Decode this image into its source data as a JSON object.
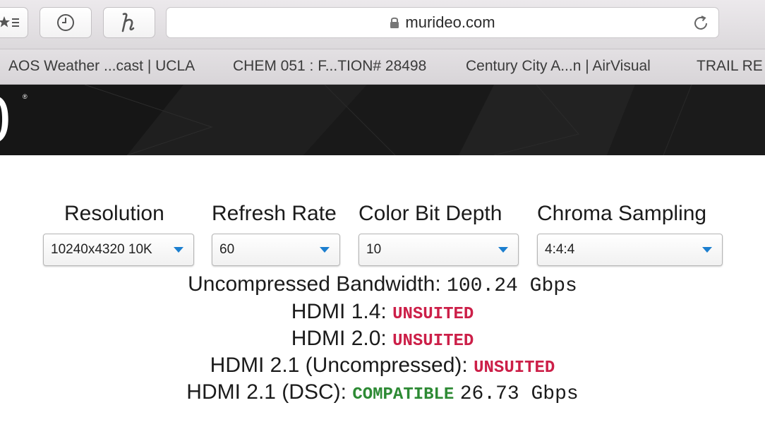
{
  "browser": {
    "url": "murideo.com",
    "bookmarks": [
      "AOS Weather ...cast | UCLA",
      "CHEM 051 : F...TION# 28498",
      "Century City A...n | AirVisual",
      "TRAIL RE"
    ]
  },
  "hero": {
    "glyph": "0",
    "registered": "®"
  },
  "calculator": {
    "resolution": {
      "label": "Resolution",
      "value": "10240x4320 10K"
    },
    "refresh_rate": {
      "label": "Refresh Rate",
      "value": "60"
    },
    "color_bit_depth": {
      "label": "Color Bit Depth",
      "value": "10"
    },
    "chroma_sampling": {
      "label": "Chroma Sampling",
      "value": "4:4:4"
    }
  },
  "results": {
    "bandwidth_label": "Uncompressed Bandwidth:",
    "bandwidth_value": "100.24 Gbps",
    "hdmi14_label": "HDMI 1.4:",
    "hdmi14_status": "UNSUITED",
    "hdmi20_label": "HDMI 2.0:",
    "hdmi20_status": "UNSUITED",
    "hdmi21u_label": "HDMI 2.1 (Uncompressed):",
    "hdmi21u_status": "UNSUITED",
    "hdmi21dsc_label": "HDMI 2.1 (DSC):",
    "hdmi21dsc_status": "COMPATIBLE",
    "hdmi21dsc_value": "26.73 Gbps"
  },
  "colors": {
    "unsuited": "#cc1f48",
    "compatible": "#2d8a34",
    "caret": "#1c7fcf"
  },
  "icons": [
    "bookmarks-icon",
    "history-icon",
    "honey-extension-icon",
    "lock-icon",
    "reload-icon"
  ]
}
